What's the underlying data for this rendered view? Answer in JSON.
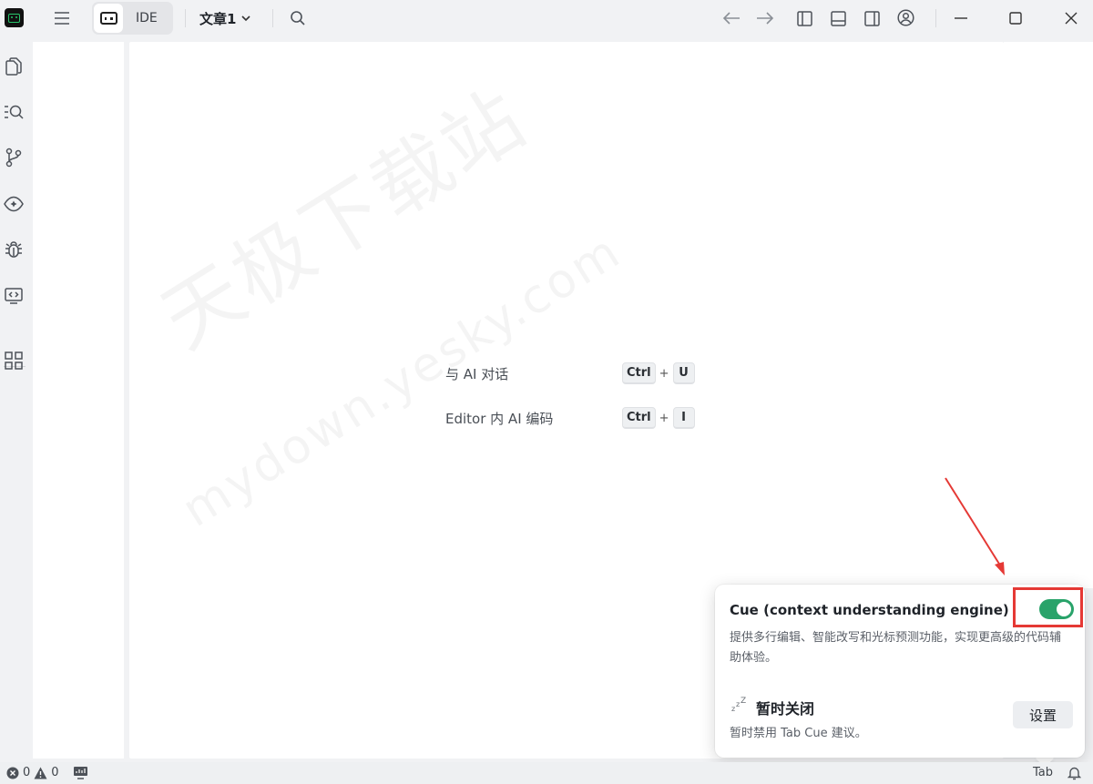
{
  "titlebar": {
    "mode_label": "IDE",
    "document_title": "文章1"
  },
  "editor": {
    "shortcuts": [
      {
        "label": "与 AI 对话",
        "keys": [
          "Ctrl",
          "U"
        ]
      },
      {
        "label": "Editor 内 AI 编码",
        "keys": [
          "Ctrl",
          "I"
        ]
      }
    ],
    "plus": "+"
  },
  "watermark": {
    "line1": "天极下载站",
    "line2": "mydown.yesky.com"
  },
  "popup": {
    "title": "Cue (context understanding engine)",
    "description": "提供多行编辑、智能改写和光标预测功能，实现更高级的代码辅助体验。",
    "toggle_on": true,
    "snooze_title": "暂时关闭",
    "snooze_description": "暂时禁用 Tab Cue 建议。",
    "settings_label": "设置"
  },
  "statusbar": {
    "errors": "0",
    "warnings": "0",
    "tab_label": "Tab"
  },
  "colors": {
    "accent_green": "#29a36a",
    "highlight_red": "#e53935"
  }
}
